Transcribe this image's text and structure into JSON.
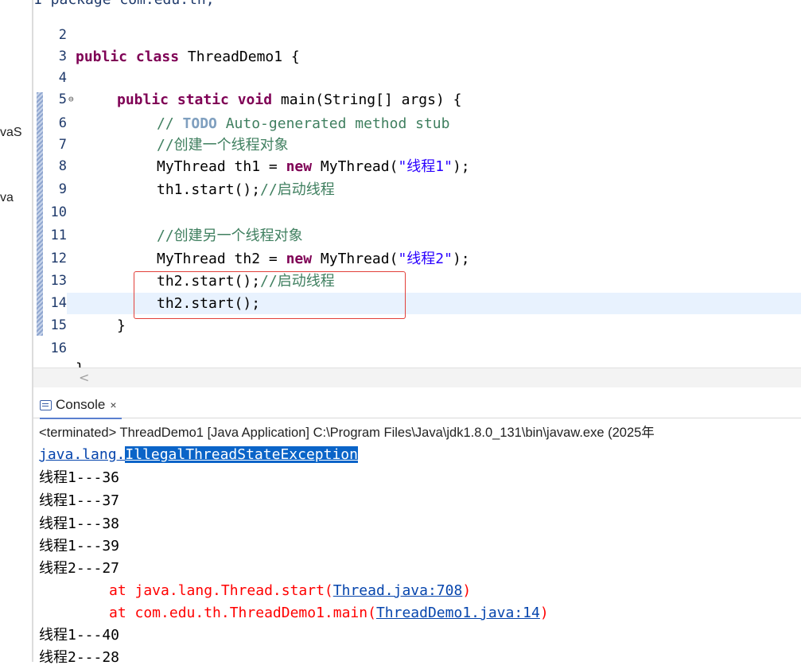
{
  "explorer": {
    "labels": [
      "vaS",
      "va"
    ]
  },
  "editor": {
    "partial_top_line": "1 package com.edu.th;",
    "lines": [
      {
        "num": "2"
      },
      {
        "num": "3"
      },
      {
        "num": "4"
      },
      {
        "num": "5",
        "fold": "⊖"
      },
      {
        "num": "6"
      },
      {
        "num": "7"
      },
      {
        "num": "8"
      },
      {
        "num": "9"
      },
      {
        "num": "10"
      },
      {
        "num": "11"
      },
      {
        "num": "12"
      },
      {
        "num": "13"
      },
      {
        "num": "14"
      },
      {
        "num": "15"
      },
      {
        "num": "16"
      }
    ],
    "code": {
      "l3_kw": "public class",
      "l3_rest": " ThreadDemo1 {",
      "l5_kw": "public static void",
      "l5_rest": " main(String[] args) {",
      "l6_cmt": "// ",
      "l6_todo": "TODO",
      "l6_rest": " Auto-generated method stub",
      "l7": "//创建一个线程对象",
      "l8_a": "MyThread th1 = ",
      "l8_kw": "new",
      "l8_b": " MyThread(",
      "l8_str": "\"线程1\"",
      "l8_c": ");",
      "l9_a": "th1.start();",
      "l9_cmt": "//启动线程",
      "l11": "//创建另一个线程对象",
      "l12_a": "MyThread th2 = ",
      "l12_kw": "new",
      "l12_b": " MyThread(",
      "l12_str": "\"线程2\"",
      "l12_c": ");",
      "l13_a": "th2.start();",
      "l13_cmt": "//启动线程",
      "l14": "th2.start();",
      "l15": "}",
      "l17": "}"
    },
    "scroll_arrow": "<"
  },
  "console": {
    "tab_label": "Console",
    "close": "×",
    "status": "<terminated> ThreadDemo1 [Java Application] C:\\Program Files\\Java\\jdk1.8.0_131\\bin\\javaw.exe  (2025年",
    "exception_pkg": "java.lang.",
    "exception_name": "IllegalThreadStateException",
    "output": [
      "线程1---36",
      "线程1---37",
      "线程1---38",
      "线程1---39",
      "线程2---27"
    ],
    "trace": [
      {
        "prefix": "\tat java.lang.Thread.start(",
        "link": "Thread.java:708",
        "suffix": ")"
      },
      {
        "prefix": "\tat com.edu.th.ThreadDemo1.main(",
        "link": "ThreadDemo1.java:14",
        "suffix": ")"
      }
    ],
    "output_after": [
      "线程1---40",
      "线程2---28"
    ]
  },
  "colors": {
    "keyword": "#7f0055",
    "string": "#2a00ff",
    "comment": "#3f7f5f",
    "error": "#ff0000",
    "highlight_box": "#e2403a"
  }
}
